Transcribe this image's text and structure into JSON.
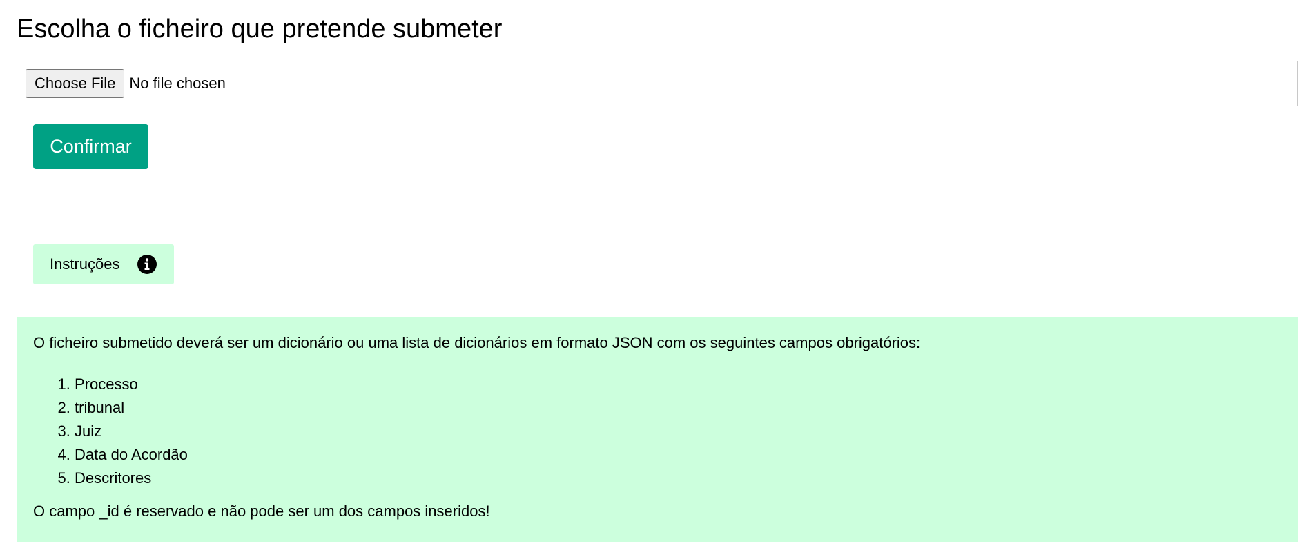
{
  "page": {
    "title": "Escolha o ficheiro que pretende submeter"
  },
  "file_input": {
    "button_label": "Choose File",
    "status": "No file chosen"
  },
  "actions": {
    "confirm_label": "Confirmar"
  },
  "instructions": {
    "toggle_label": "Instruções",
    "intro": "O ficheiro submetido deverá ser um dicionário ou uma lista de dicionários em formato JSON com os seguintes campos obrigatórios:",
    "fields": [
      "Processo",
      "tribunal",
      "Juiz",
      "Data do Acordão",
      "Descritores"
    ],
    "note": "O campo _id é reservado e não pode ser um dos campos inseridos!"
  },
  "colors": {
    "accent": "#00a184",
    "panel_background": "#ccffdd"
  },
  "icons": {
    "info": "info-circle-icon"
  }
}
